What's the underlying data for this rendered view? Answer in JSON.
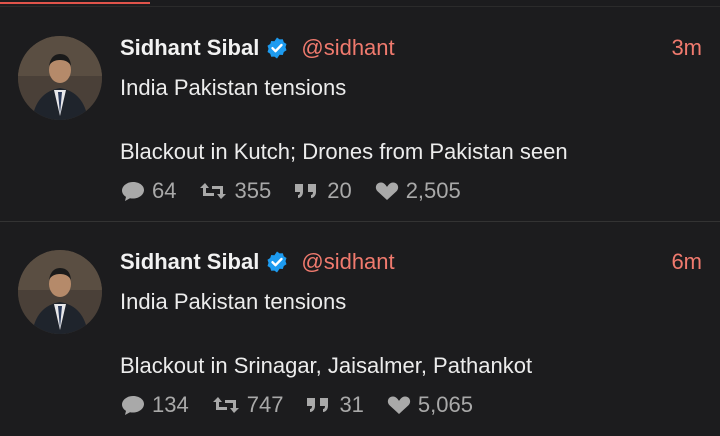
{
  "tweets": [
    {
      "name": "Sidhant Sibal",
      "handle": "@sidhant",
      "time": "3m",
      "lines": [
        "India Pakistan tensions",
        "Blackout in Kutch; Drones from Pakistan seen"
      ],
      "replies": "64",
      "retweets": "355",
      "quotes": "20",
      "likes": "2,505"
    },
    {
      "name": "Sidhant Sibal",
      "handle": "@sidhant",
      "time": "6m",
      "lines": [
        "India Pakistan tensions",
        "Blackout in Srinagar, Jaisalmer, Pathankot"
      ],
      "replies": "134",
      "retweets": "747",
      "quotes": "31",
      "likes": "5,065"
    }
  ],
  "icons": {
    "verified": "verified-badge-icon",
    "reply": "speech-bubble-icon",
    "retweet": "retweet-arrows-icon",
    "quote": "quote-marks-icon",
    "like": "heart-icon"
  },
  "colors": {
    "background": "#1c1c1e",
    "accent": "#f07a6e",
    "verified": "#1d9bf0",
    "muted": "#a9a9a9"
  }
}
